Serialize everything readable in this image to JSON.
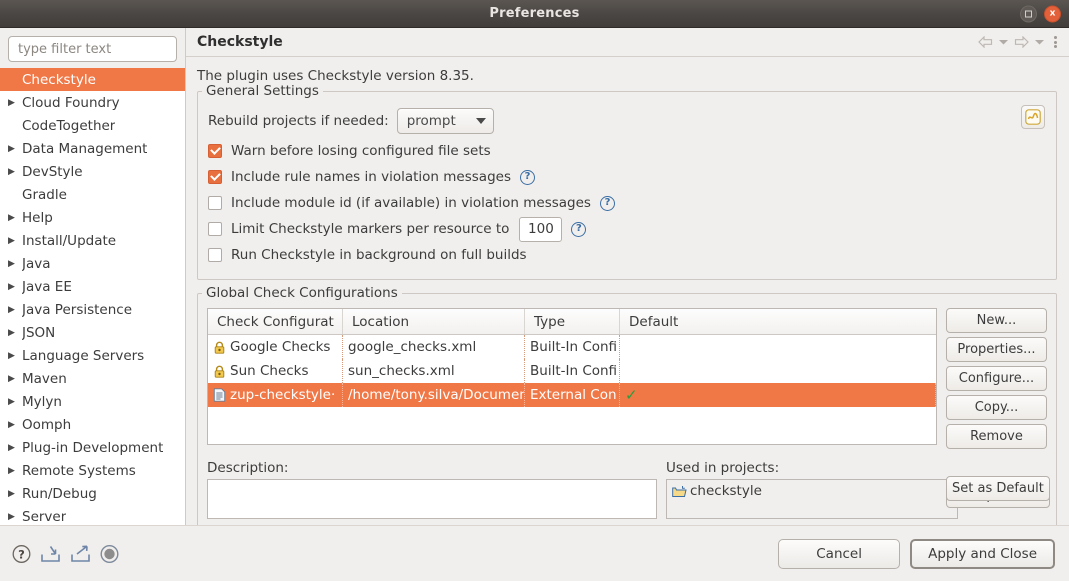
{
  "window": {
    "title": "Preferences",
    "maximize_label": "Maximize",
    "close_label": "x"
  },
  "sidebar": {
    "filter_placeholder": "type filter text",
    "filter_value": "",
    "items": [
      {
        "label": "Checkstyle",
        "expandable": false,
        "selected": true
      },
      {
        "label": "Cloud Foundry",
        "expandable": true,
        "selected": false
      },
      {
        "label": "CodeTogether",
        "expandable": false,
        "selected": false
      },
      {
        "label": "Data Management",
        "expandable": true,
        "selected": false
      },
      {
        "label": "DevStyle",
        "expandable": true,
        "selected": false
      },
      {
        "label": "Gradle",
        "expandable": false,
        "selected": false
      },
      {
        "label": "Help",
        "expandable": true,
        "selected": false
      },
      {
        "label": "Install/Update",
        "expandable": true,
        "selected": false
      },
      {
        "label": "Java",
        "expandable": true,
        "selected": false
      },
      {
        "label": "Java EE",
        "expandable": true,
        "selected": false
      },
      {
        "label": "Java Persistence",
        "expandable": true,
        "selected": false
      },
      {
        "label": "JSON",
        "expandable": true,
        "selected": false
      },
      {
        "label": "Language Servers",
        "expandable": true,
        "selected": false
      },
      {
        "label": "Maven",
        "expandable": true,
        "selected": false
      },
      {
        "label": "Mylyn",
        "expandable": true,
        "selected": false
      },
      {
        "label": "Oomph",
        "expandable": true,
        "selected": false
      },
      {
        "label": "Plug-in Development",
        "expandable": true,
        "selected": false
      },
      {
        "label": "Remote Systems",
        "expandable": true,
        "selected": false
      },
      {
        "label": "Run/Debug",
        "expandable": true,
        "selected": false
      },
      {
        "label": "Server",
        "expandable": true,
        "selected": false
      }
    ]
  },
  "header": {
    "title": "Checkstyle",
    "nav": {
      "back_icon": "back-arrow-icon",
      "back_menu_icon": "chevron-down-icon",
      "forward_icon": "forward-arrow-icon",
      "forward_menu_icon": "chevron-down-icon",
      "menu_icon": "vertical-dots-icon"
    }
  },
  "main": {
    "version_text": "The plugin uses Checkstyle version 8.35.",
    "general_settings": {
      "title": "General Settings",
      "rebuild_label": "Rebuild projects if needed:",
      "rebuild_value": "prompt",
      "corner_icon": "checkstyle-config-icon",
      "checkboxes": [
        {
          "label": "Warn before losing configured file sets",
          "checked": true,
          "help": false,
          "extra": "none"
        },
        {
          "label": "Include rule names in violation messages",
          "checked": true,
          "help": true,
          "extra": "none"
        },
        {
          "label": "Include module id (if available) in violation messages",
          "checked": false,
          "help": true,
          "extra": "none"
        },
        {
          "label": "Limit Checkstyle markers per resource to",
          "checked": false,
          "help": true,
          "extra": "number"
        },
        {
          "label": "Run Checkstyle in background on full builds",
          "checked": false,
          "help": false,
          "extra": "none"
        }
      ],
      "limit_value": "100"
    },
    "global_configs": {
      "title": "Global Check Configurations",
      "columns": [
        "Check Configurat",
        "Location",
        "Type",
        "Default"
      ],
      "rows": [
        {
          "icon": "lock-icon",
          "name": "Google Checks",
          "location": "google_checks.xml",
          "type": "Built-In Confi",
          "default": "",
          "selected": false
        },
        {
          "icon": "lock-icon",
          "name": "Sun Checks",
          "location": "sun_checks.xml",
          "type": "Built-In Confi",
          "default": "",
          "selected": false
        },
        {
          "icon": "document-icon",
          "name": "zup-checkstyle·",
          "location": "/home/tony.silva/Documents/р",
          "type": "External Con",
          "default": "✓",
          "selected": true
        }
      ],
      "buttons": [
        "New...",
        "Properties...",
        "Configure...",
        "Copy...",
        "Remove",
        "Export..."
      ],
      "default_button": "Set as Default"
    },
    "description_label": "Description:",
    "description_value": "",
    "used_in_projects_label": "Used in projects:",
    "used_in_projects": [
      {
        "icon": "folder-icon",
        "label": "checkstyle"
      }
    ]
  },
  "footer": {
    "icons": [
      {
        "name": "help-icon",
        "glyph": "?"
      },
      {
        "name": "import-icon",
        "glyph": "import"
      },
      {
        "name": "export-icon",
        "glyph": "export"
      },
      {
        "name": "restore-defaults-icon",
        "glyph": "circle"
      }
    ],
    "cancel_label": "Cancel",
    "apply_label": "Apply and Close"
  },
  "colors": {
    "accent": "#f07746",
    "checkbox_on": "#e8703f",
    "titlebar": "#4b4744",
    "close_button": "#e2613a",
    "check_green": "#2e9b3e",
    "help_blue": "#3a6ea5"
  }
}
